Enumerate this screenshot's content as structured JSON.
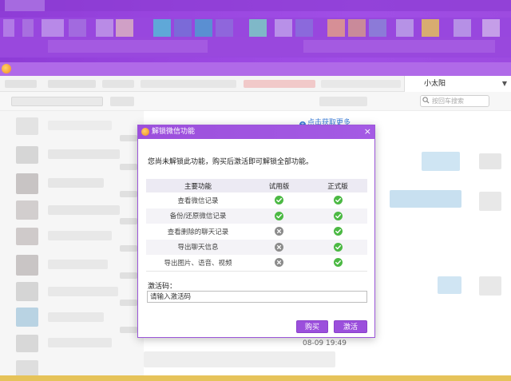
{
  "window": {
    "account_name": "小太阳",
    "search_placeholder": "按回车搜索",
    "load_more": "点击获取更多",
    "message_time": "08-09 19:49"
  },
  "dialog": {
    "title": "解锁微信功能",
    "notice": "您尚未解锁此功能，购买后激活即可解锁全部功能。",
    "table": {
      "headers": [
        "主要功能",
        "试用版",
        "正式版"
      ],
      "rows": [
        {
          "feature": "查看微信记录",
          "trial": true,
          "pro": true
        },
        {
          "feature": "备份/还原微信记录",
          "trial": true,
          "pro": true
        },
        {
          "feature": "查看删除的聊天记录",
          "trial": false,
          "pro": true
        },
        {
          "feature": "导出聊天信息",
          "trial": false,
          "pro": true
        },
        {
          "feature": "导出图片、语音、视频",
          "trial": false,
          "pro": true
        }
      ]
    },
    "activation_label": "激活码：",
    "activation_placeholder": "请输入激活码",
    "buy_label": "购买",
    "activate_label": "激活"
  },
  "colors": {
    "accent": "#9b4fdc",
    "check_green": "#4cb944",
    "cross_gray": "#8c8c8c",
    "link_blue": "#3b7dd8"
  },
  "icons": {
    "available": "check-circle-icon",
    "unavailable": "cross-circle-icon"
  }
}
